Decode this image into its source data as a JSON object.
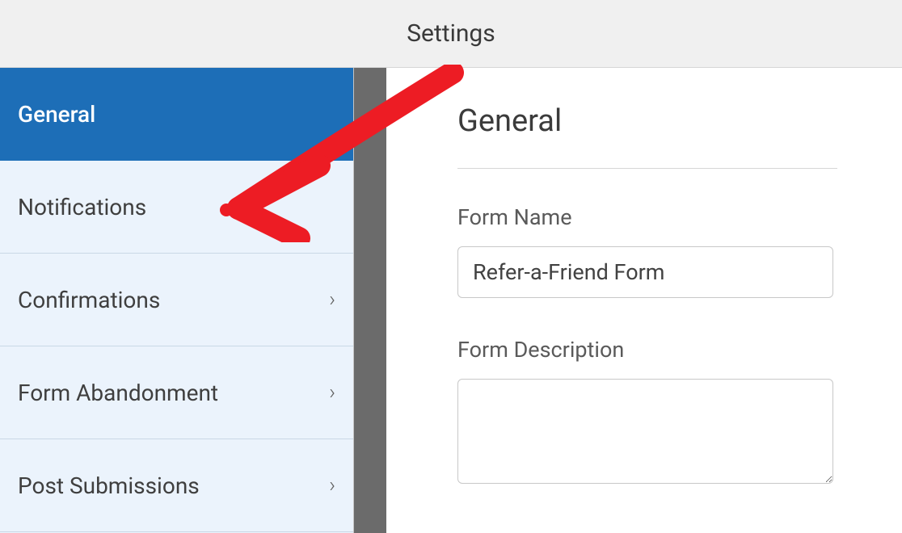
{
  "header": {
    "title": "Settings"
  },
  "sidebar": {
    "items": [
      {
        "label": "General",
        "active": true,
        "has_chevron": false
      },
      {
        "label": "Notifications",
        "active": false,
        "has_chevron": false
      },
      {
        "label": "Confirmations",
        "active": false,
        "has_chevron": true
      },
      {
        "label": "Form Abandonment",
        "active": false,
        "has_chevron": true
      },
      {
        "label": "Post Submissions",
        "active": false,
        "has_chevron": true
      }
    ]
  },
  "main": {
    "title": "General",
    "form_name_label": "Form Name",
    "form_name_value": "Refer-a-Friend Form",
    "form_description_label": "Form Description",
    "form_description_value": ""
  },
  "annotation": {
    "arrow_color": "#ed1c24",
    "points_to": "Notifications"
  }
}
